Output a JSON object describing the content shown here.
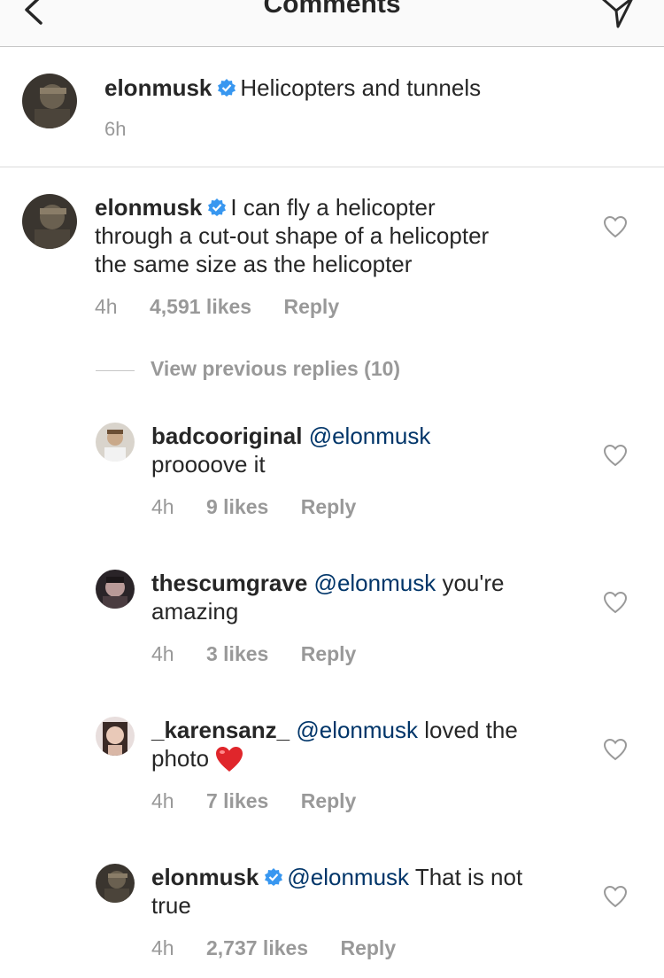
{
  "header": {
    "title": "Comments"
  },
  "caption": {
    "username": "elonmusk",
    "text": "Helicopters and tunnels",
    "time": "6h"
  },
  "comment": {
    "username": "elonmusk",
    "line1": "I can fly a helicopter",
    "line2": "through a cut-out shape of a helicopter",
    "line3": "the same size as the helicopter",
    "time": "4h",
    "likes": "4,591 likes",
    "reply": "Reply"
  },
  "view_previous": "View previous replies (10)",
  "replies": [
    {
      "username": "badcooriginal",
      "mention": "@elonmusk",
      "text_inline": "",
      "text_line2": "proooove it",
      "time": "4h",
      "likes": "9 likes",
      "reply": "Reply"
    },
    {
      "username": "thescumgrave",
      "mention": "@elonmusk",
      "text_inline": "you're",
      "text_line2": "amazing",
      "time": "4h",
      "likes": "3 likes",
      "reply": "Reply"
    },
    {
      "username": "_karensanz_",
      "mention": "@elonmusk",
      "text_inline": "loved the",
      "text_line2": "photo",
      "emoji": "red-heart",
      "time": "4h",
      "likes": "7 likes",
      "reply": "Reply"
    },
    {
      "username": "elonmusk",
      "verified": true,
      "mention": "@elonmusk",
      "text_inline": "That is not",
      "text_line2": "true",
      "time": "4h",
      "likes": "2,737 likes",
      "reply": "Reply"
    }
  ],
  "icons": {
    "back": "chevron-left-icon",
    "send": "paper-plane-icon",
    "verified": "verified-badge-icon",
    "like": "heart-outline-icon"
  },
  "colors": {
    "mention": "#003569",
    "verified": "#3897f0",
    "meta": "#999999",
    "emoji_heart": "#e0262b"
  }
}
